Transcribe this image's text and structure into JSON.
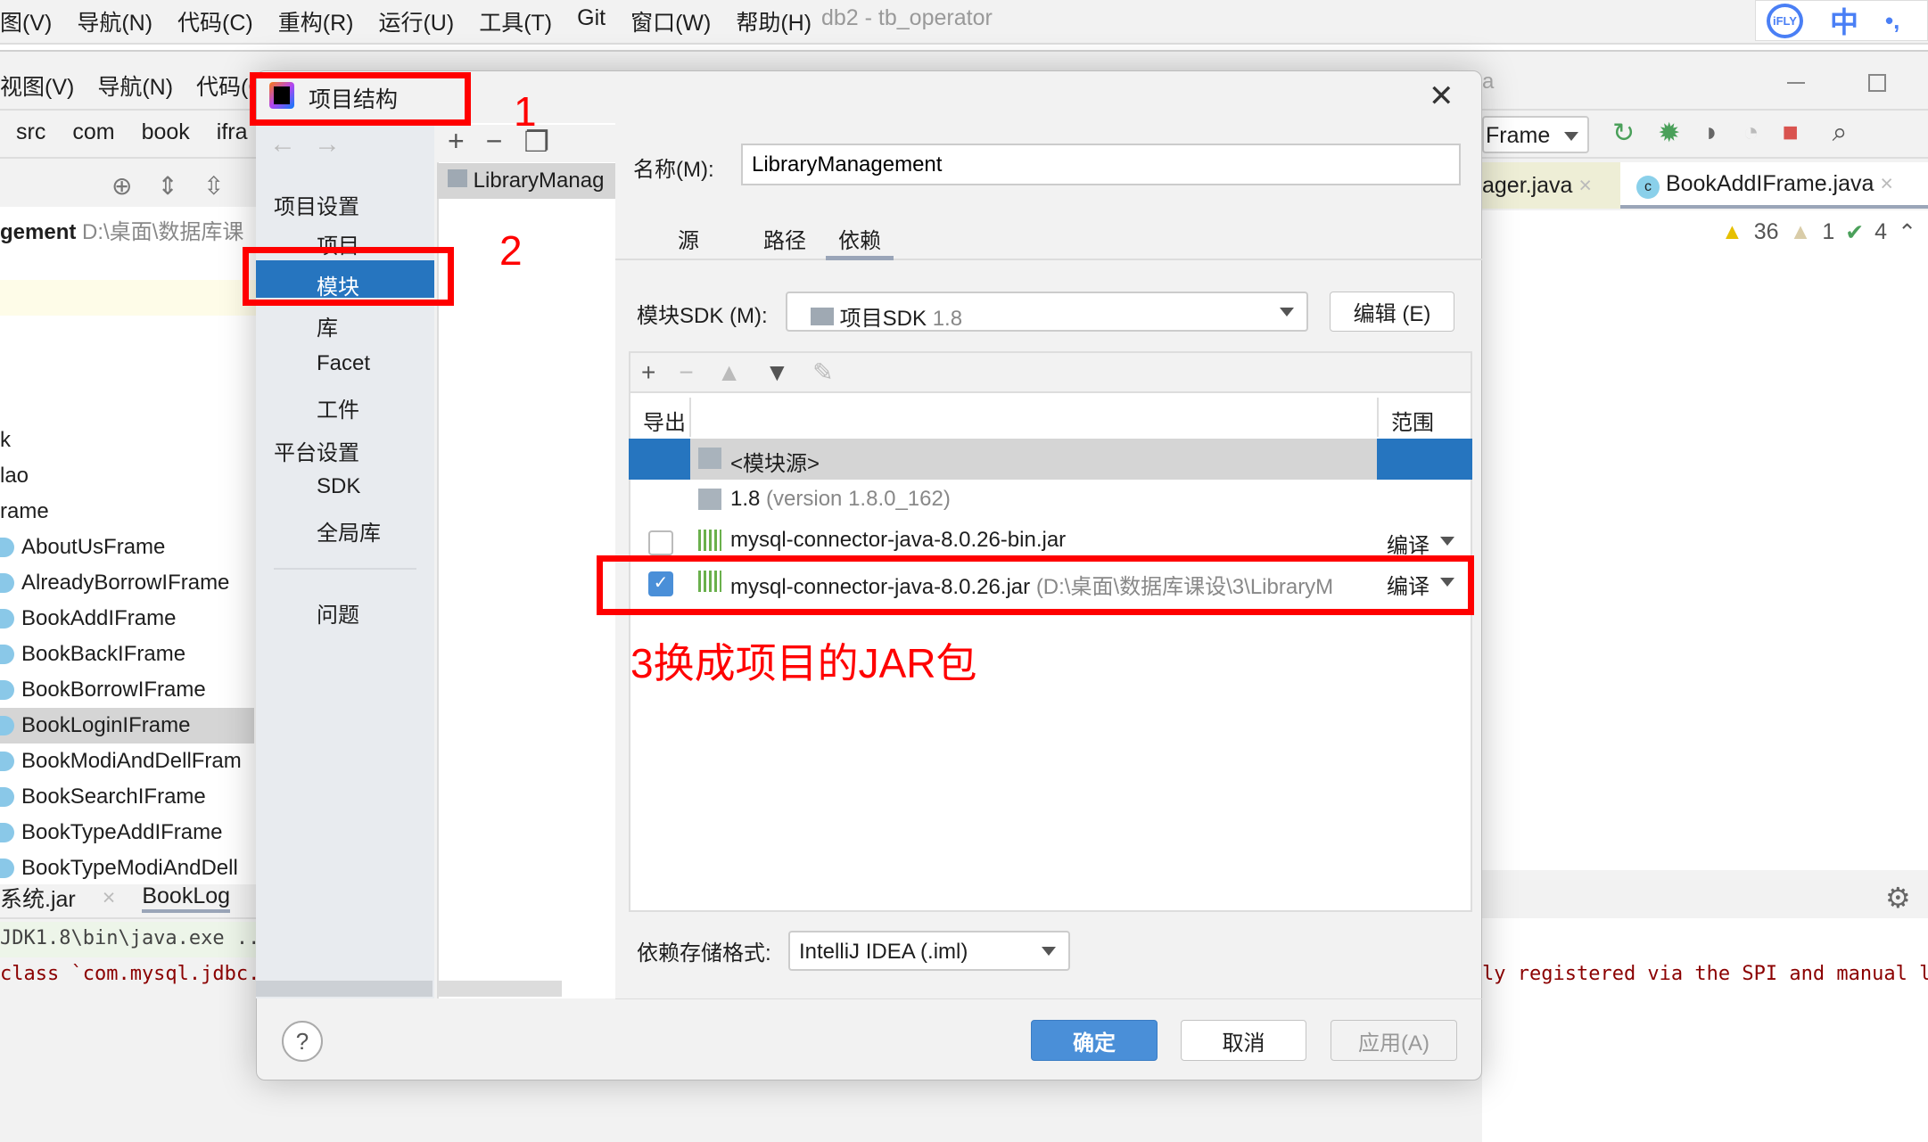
{
  "top_menu": {
    "items": [
      "图(V)",
      "导航(N)",
      "代码(C)",
      "重构(R)",
      "运行(U)",
      "工具(T)",
      "Git",
      "窗口(W)",
      "帮助(H)"
    ],
    "title": "db2 - tb_operator"
  },
  "ime": {
    "logo": "iFLY",
    "lang": "中",
    "punct": "•,"
  },
  "ide2_menu": {
    "items": [
      "视图(V)",
      "导航(N)",
      "代码(C"
    ]
  },
  "breadcrumb": [
    "src",
    "com",
    "book",
    "ifra"
  ],
  "project_header": {
    "name": "gement",
    "path": "D:\\桌面\\数据库课"
  },
  "tree": [
    {
      "label": "k",
      "icon": false
    },
    {
      "label": "lao",
      "icon": false
    },
    {
      "label": "rame",
      "icon": false
    },
    {
      "label": "AboutUsFrame",
      "icon": true
    },
    {
      "label": "AlreadyBorrowIFrame",
      "icon": true
    },
    {
      "label": "BookAddIFrame",
      "icon": true
    },
    {
      "label": "BookBackIFrame",
      "icon": true
    },
    {
      "label": "BookBorrowIFrame",
      "icon": true
    },
    {
      "label": "BookLoginIFrame",
      "icon": true,
      "selected": true
    },
    {
      "label": "BookModiAndDellFram",
      "icon": true
    },
    {
      "label": "BookSearchIFrame",
      "icon": true
    },
    {
      "label": "BookTypeAddIFrame",
      "icon": true
    },
    {
      "label": "BookTypeModiAndDell",
      "icon": true
    }
  ],
  "bottom_tabs": [
    "系统.jar",
    "BookLog"
  ],
  "console": {
    "line1": "JDK1.8\\bin\\java.exe ..",
    "line2": "class `com.mysql.jdbc.",
    "line2_right": "ly registered via the SPI and manual lo"
  },
  "right_ide": {
    "title_frag": "a",
    "run_config": "Frame",
    "tabs": [
      "ager.java",
      "BookAddIFrame.java"
    ],
    "inspections": {
      "warnings": "36",
      "weak_warnings": "1",
      "ok": "4"
    }
  },
  "dialog": {
    "title": "项目结构",
    "nav": {
      "sections": [
        {
          "header": "项目设置",
          "items": [
            "项目",
            "模块",
            "库",
            "Facet",
            "工件"
          ]
        },
        {
          "header": "平台设置",
          "items": [
            "SDK",
            "全局库"
          ]
        }
      ],
      "problems": "问题",
      "selected": "模块"
    },
    "modules": [
      "LibraryManag"
    ],
    "name_label": "名称(M):",
    "name_value": "LibraryManagement",
    "tabs": [
      "源",
      "路径",
      "依赖"
    ],
    "active_tab": "依赖",
    "sdk_label": "模块SDK (M):",
    "sdk_value": "项目SDK",
    "sdk_version": "1.8",
    "edit_button": "编辑 (E)",
    "table": {
      "headers": [
        "导出",
        "",
        "范围"
      ],
      "rows": [
        {
          "name": "<模块源>",
          "detail": "",
          "scope": "",
          "checkbox": null,
          "selected": true
        },
        {
          "name": "1.8",
          "detail": "(version 1.8.0_162)",
          "scope": "",
          "checkbox": null
        },
        {
          "name": "mysql-connector-java-8.0.26-bin.jar",
          "detail": "",
          "scope": "编译",
          "checkbox": false
        },
        {
          "name": "mysql-connector-java-8.0.26.jar",
          "detail": "(D:\\桌面\\数据库课设\\3\\LibraryM",
          "scope": "编译",
          "checkbox": true
        }
      ]
    },
    "format_label": "依赖存储格式:",
    "format_value": "IntelliJ IDEA (.iml)",
    "buttons": {
      "ok": "确定",
      "cancel": "取消",
      "apply": "应用(A)",
      "help": "?"
    }
  },
  "annotations": {
    "n1": "1",
    "n2": "2",
    "n3": "3换成项目的JAR包",
    "color": "#ff0000"
  },
  "colors": {
    "accent": "#2675bf",
    "selection": "#d5d5d5"
  }
}
